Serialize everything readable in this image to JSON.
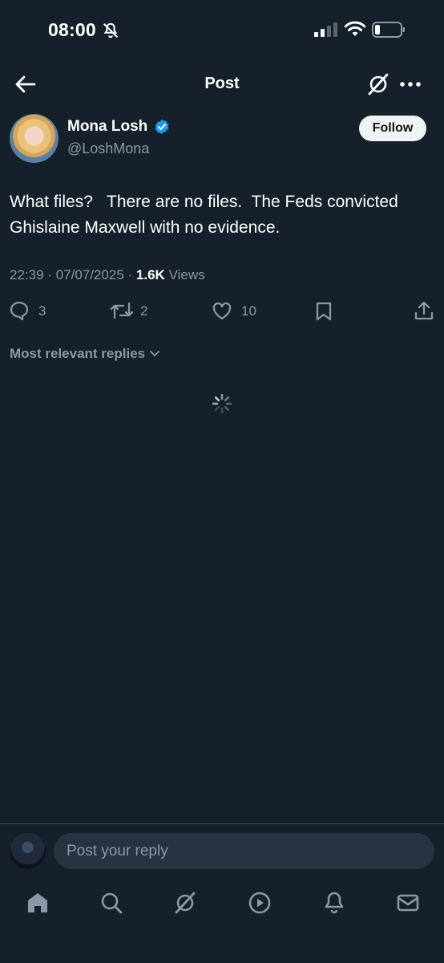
{
  "status_bar": {
    "time": "08:00"
  },
  "header": {
    "title": "Post"
  },
  "author": {
    "name": "Mona Losh",
    "handle": "@LoshMona",
    "follow_label": "Follow"
  },
  "post": {
    "text": "What files?   There are no files.  The Feds convicted Ghislaine Maxwell with no evidence.",
    "time": "22:39",
    "date": "07/07/2025",
    "views_count": "1.6K",
    "views_label": "Views"
  },
  "actions": {
    "replies": "3",
    "reposts": "2",
    "likes": "10"
  },
  "replies_filter": {
    "label": "Most relevant replies"
  },
  "reply_box": {
    "placeholder": "Post your reply"
  },
  "colors": {
    "background": "#15202b",
    "accent": "#1d9bf0",
    "muted": "#8b98a5"
  },
  "icons": {
    "back": "arrow-left-icon",
    "grok": "grok-icon",
    "more": "more-dots-icon",
    "verified": "verified-badge-icon",
    "reply": "reply-bubble-icon",
    "repost": "repost-icon",
    "like": "heart-icon",
    "bookmark": "bookmark-icon",
    "share": "share-icon",
    "spinner": "loading-spinner-icon",
    "nav": [
      "home-icon",
      "search-icon",
      "grok-icon",
      "play-icon",
      "bell-icon",
      "mail-icon"
    ]
  }
}
